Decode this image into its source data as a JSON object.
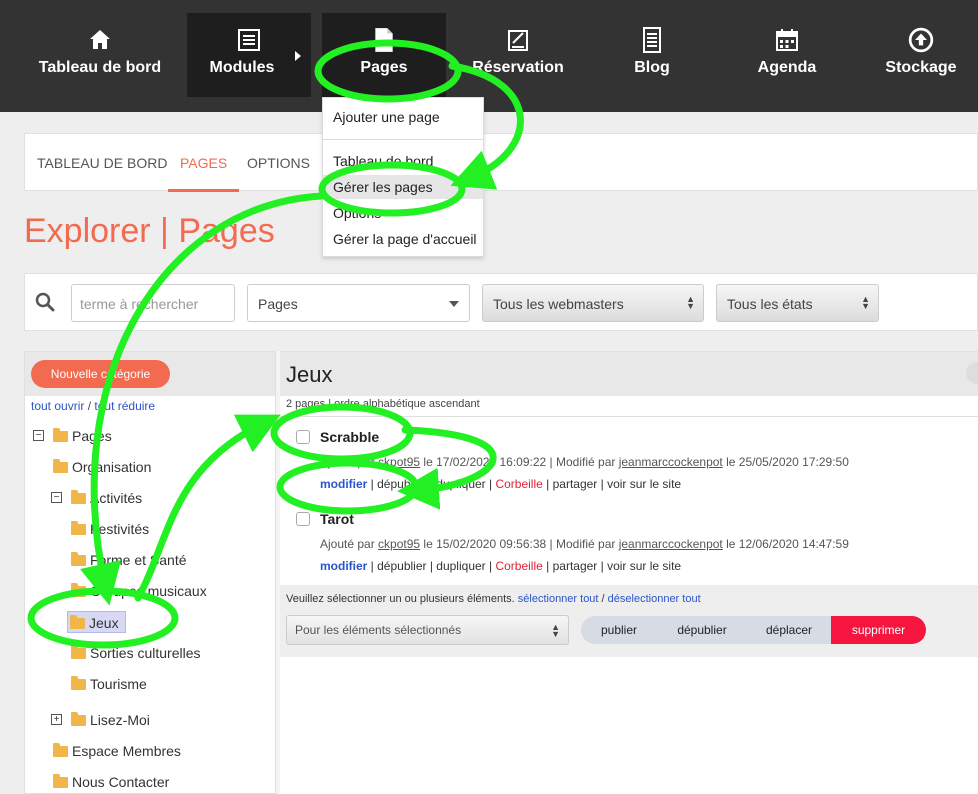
{
  "nav": {
    "items": [
      {
        "label": "Tableau de bord",
        "icon": "home-icon"
      },
      {
        "label": "Modules",
        "icon": "list-icon"
      },
      {
        "label": "Pages",
        "icon": "page-icon"
      },
      {
        "label": "Réservation",
        "icon": "booking-icon"
      },
      {
        "label": "Blog",
        "icon": "blog-icon"
      },
      {
        "label": "Agenda",
        "icon": "calendar-icon"
      },
      {
        "label": "Stockage",
        "icon": "upload-icon"
      }
    ]
  },
  "dropdown": {
    "items": [
      "Ajouter une page",
      "Tableau de bord",
      "Gérer les pages",
      "Options",
      "Gérer la page d'accueil"
    ]
  },
  "tabs": [
    "TABLEAU DE BORD",
    "PAGES",
    "OPTIONS"
  ],
  "page_title": "Explorer | Pages",
  "search": {
    "placeholder": "terme à rechercher",
    "type_value": "Pages",
    "webmasters_value": "Tous les webmasters",
    "states_value": "Tous les états"
  },
  "left": {
    "new_category": "Nouvelle catégorie",
    "open_all": "tout ouvrir",
    "link_sep": "/",
    "reduce_all": "tout réduire",
    "tree": [
      "Pages",
      "Organisation",
      "Activités",
      "Festivités",
      "Forme et Santé",
      "Groupes musicaux",
      "Jeux",
      "Sorties culturelles",
      "Tourisme",
      "Lisez-Moi",
      "Espace Membres",
      "Nous Contacter"
    ]
  },
  "right": {
    "title": "Jeux",
    "sort_info": "2 pages | ordre alphabétique ascendant",
    "items": [
      {
        "title": "Scrabble",
        "added_prefix": "Ajouté par",
        "added_user": "ckpot95",
        "added_date": "le 17/02/2020 16:09:22",
        "mod_prefix": "| Modifié par",
        "mod_user": "jeanmarccockenpot",
        "mod_date": "le 25/05/2020 17:29:50"
      },
      {
        "title": "Tarot",
        "added_prefix": "Ajouté par",
        "added_user": "ckpot95",
        "added_date": "le 15/02/2020 09:56:38",
        "mod_prefix": "| Modifié par",
        "mod_user": "jeanmarccockenpot",
        "mod_date": "le 12/06/2020 14:47:59"
      }
    ],
    "actions": {
      "modify": "modifier",
      "mid": " | dépublier | dupliquer | ",
      "trash": "Corbeille",
      "end": " | partager | voir sur le site"
    },
    "bottom": {
      "message": "Veuillez sélectionner un ou plusieurs éléments.",
      "select_all": "sélectionner tout",
      "sep": "/",
      "deselect_all": "déselectionner tout",
      "bulk_placeholder": "Pour les éléments sélectionnés",
      "buttons": [
        "publier",
        "dépublier",
        "déplacer",
        "supprimer"
      ]
    }
  },
  "colors": {
    "accent": "#f26a4f",
    "annotation": "#22f022",
    "danger": "#f5153f",
    "link": "#2b55c8"
  }
}
